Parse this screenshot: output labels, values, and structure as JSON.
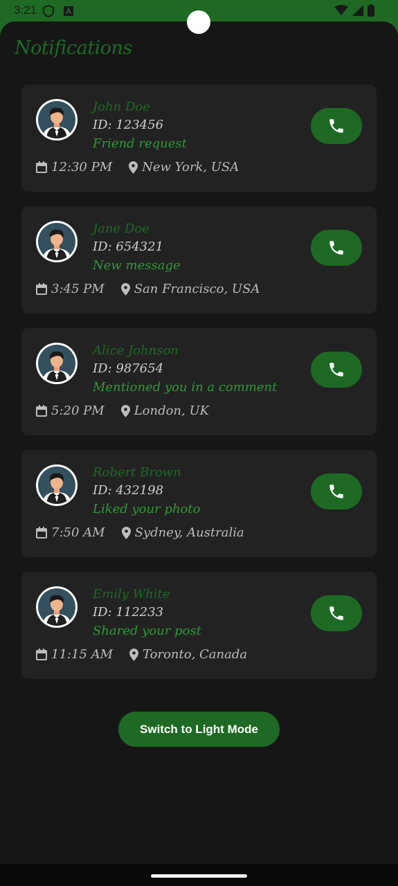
{
  "status_bar": {
    "time": "3:21",
    "left_icons": [
      "shield-icon",
      "a-badge-icon"
    ],
    "right_icons": [
      "wifi-icon",
      "signal-icon",
      "battery-icon"
    ]
  },
  "header": {
    "title": "Notifications"
  },
  "notifications": [
    {
      "name": "John Doe",
      "id": "ID: 123456",
      "message": "Friend request",
      "time": "12:30 PM",
      "location": "New York, USA"
    },
    {
      "name": "Jane Doe",
      "id": "ID: 654321",
      "message": "New message",
      "time": "3:45 PM",
      "location": "San Francisco, USA"
    },
    {
      "name": "Alice Johnson",
      "id": "ID: 987654",
      "message": "Mentioned you in a comment",
      "time": "5:20 PM",
      "location": "London, UK"
    },
    {
      "name": "Robert Brown",
      "id": "ID: 432198",
      "message": "Liked your photo",
      "time": "7:50 AM",
      "location": "Sydney, Australia"
    },
    {
      "name": "Emily White",
      "id": "ID: 112233",
      "message": "Shared your post",
      "time": "11:15 AM",
      "location": "Toronto, Canada"
    }
  ],
  "switch_button": {
    "label": "Switch to Light Mode"
  },
  "colors": {
    "background": "#161616",
    "card": "#222222",
    "accent": "#1e6a24",
    "accent_text": "#2f9a38"
  }
}
